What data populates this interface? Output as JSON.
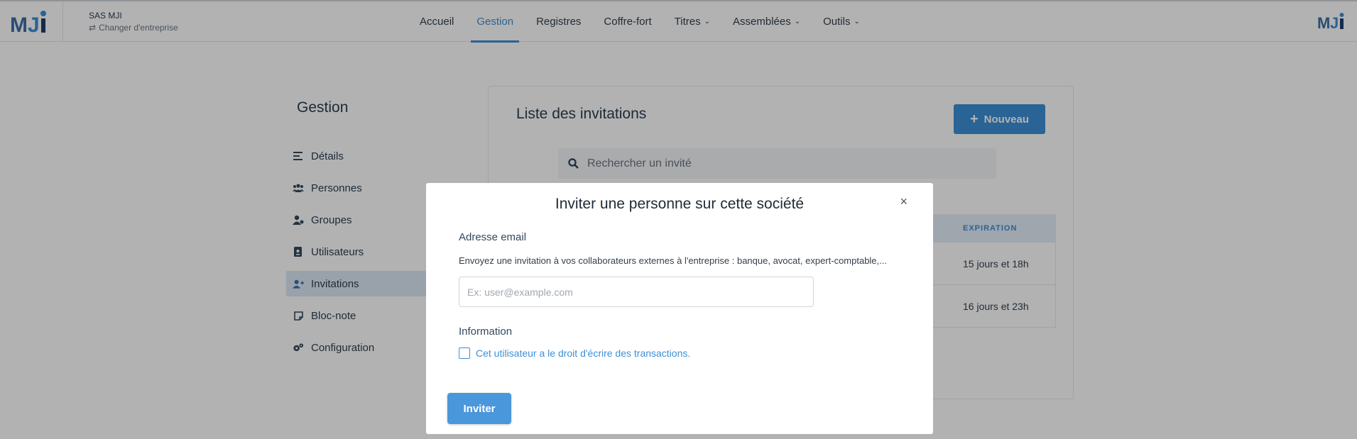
{
  "header": {
    "company_name": "SAS MJI",
    "switch_company": "Changer d'entreprise",
    "nav": [
      {
        "label": "Accueil"
      },
      {
        "label": "Gestion",
        "active": true
      },
      {
        "label": "Registres"
      },
      {
        "label": "Coffre-fort"
      },
      {
        "label": "Titres",
        "dropdown": true
      },
      {
        "label": "Assemblées",
        "dropdown": true
      },
      {
        "label": "Outils",
        "dropdown": true
      }
    ]
  },
  "sidebar": {
    "title": "Gestion",
    "items": [
      {
        "label": "Détails",
        "icon": "align-left-icon"
      },
      {
        "label": "Personnes",
        "icon": "users-icon"
      },
      {
        "label": "Groupes",
        "icon": "user-group-icon"
      },
      {
        "label": "Utilisateurs",
        "icon": "id-badge-icon"
      },
      {
        "label": "Invitations",
        "icon": "user-plus-icon",
        "active": true
      },
      {
        "label": "Bloc-note",
        "icon": "sticky-note-icon"
      },
      {
        "label": "Configuration",
        "icon": "cogs-icon"
      }
    ]
  },
  "main": {
    "title": "Liste des invitations",
    "new_button": "Nouveau",
    "search_placeholder": "Rechercher un invité",
    "table": {
      "column": "EXPIRATION",
      "rows": [
        "15 jours et 18h",
        "16 jours et 23h"
      ]
    }
  },
  "modal": {
    "title": "Inviter une personne sur cette société",
    "email_label": "Adresse email",
    "help_text": "Envoyez une invitation à vos collaborateurs externes à l'entreprise : banque, avocat, expert-comptable,...",
    "email_placeholder": "Ex: user@example.com",
    "info_label": "Information",
    "checkbox_label": "Cet utilisateur a le droit d'écrire des transactions.",
    "checkbox_checked": false,
    "submit": "Inviter",
    "close": "×"
  },
  "colors": {
    "accent": "#3d8fd6",
    "logo_dark": "#1f3f6b",
    "logo_light": "#3d8fd6"
  }
}
